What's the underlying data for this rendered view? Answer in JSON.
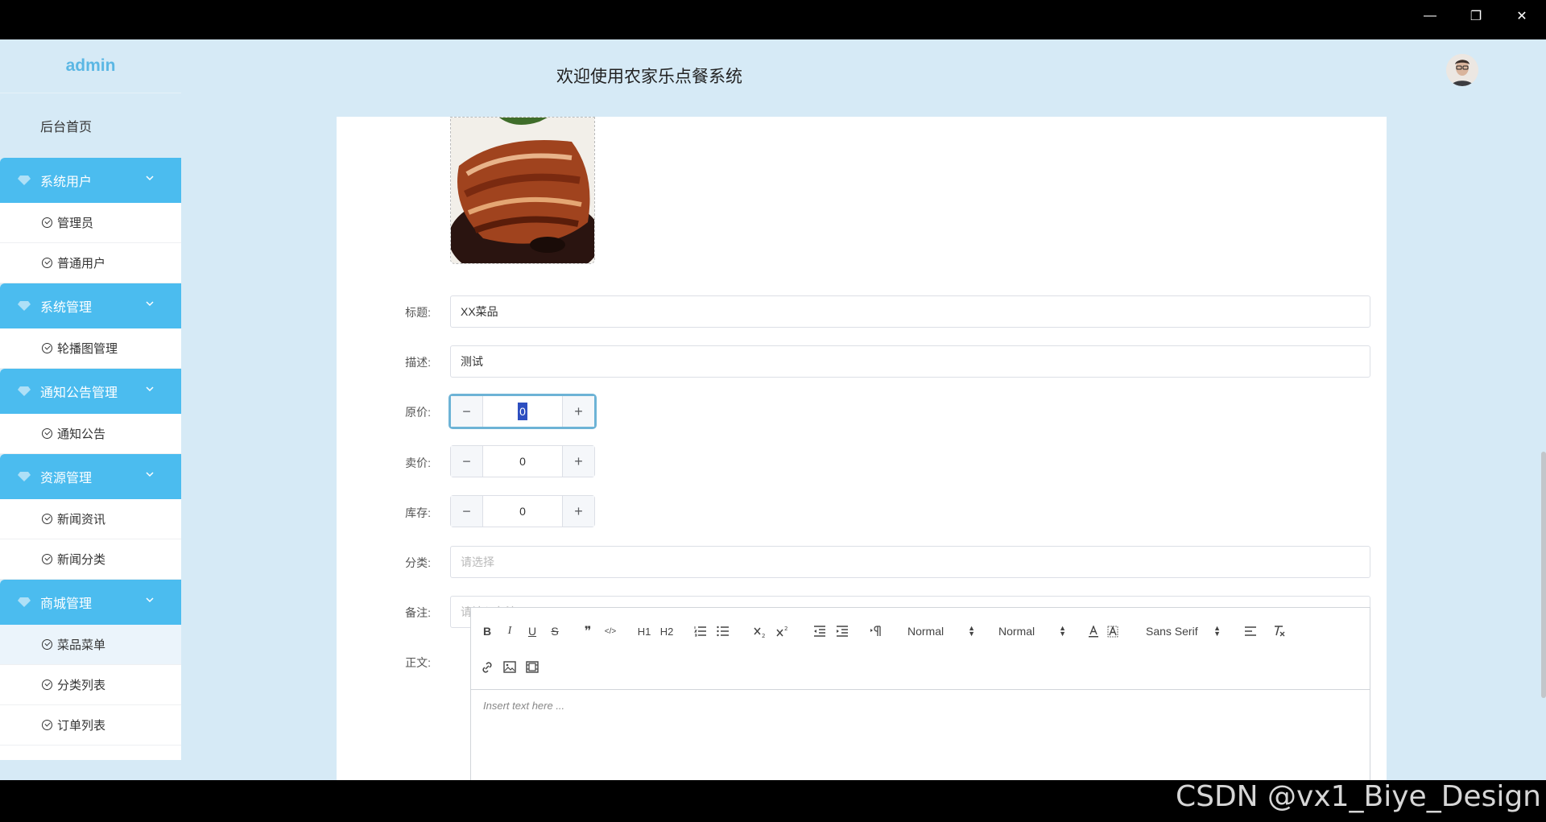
{
  "window": {
    "minimize": "—",
    "restore": "❐",
    "close": "✕"
  },
  "sidebar": {
    "brand": "admin",
    "home": "后台首页",
    "groups": [
      {
        "label": "系统用户",
        "items": [
          "管理员",
          "普通用户"
        ]
      },
      {
        "label": "系统管理",
        "items": [
          "轮播图管理"
        ]
      },
      {
        "label": "通知公告管理",
        "items": [
          "通知公告"
        ]
      },
      {
        "label": "资源管理",
        "items": [
          "新闻资讯",
          "新闻分类"
        ]
      },
      {
        "label": "商城管理",
        "items": [
          "菜品菜单",
          "分类列表",
          "订单列表"
        ]
      }
    ]
  },
  "header": {
    "title": "欢迎使用农家乐点餐系统"
  },
  "form": {
    "title_label": "标题:",
    "title_value": "XX菜品",
    "desc_label": "描述:",
    "desc_value": "测试",
    "orig_price_label": "原价:",
    "orig_price_value": "0",
    "sale_price_label": "卖价:",
    "sale_price_value": "0",
    "stock_label": "库存:",
    "stock_value": "0",
    "category_label": "分类:",
    "category_placeholder": "请选择",
    "remark_label": "备注:",
    "remark_placeholder": "请输入备注",
    "content_label": "正文:",
    "minus": "−",
    "plus": "+"
  },
  "editor": {
    "bold": "B",
    "italic": "I",
    "underline": "U",
    "strike": "S",
    "quote": "❞",
    "code": "</>",
    "h1": "H1",
    "h2": "H2",
    "header_size": "Normal",
    "font_size": "Normal",
    "font_family": "Sans Serif",
    "placeholder": "Insert text here ..."
  },
  "watermark": "CSDN @vx1_Biye_Design"
}
